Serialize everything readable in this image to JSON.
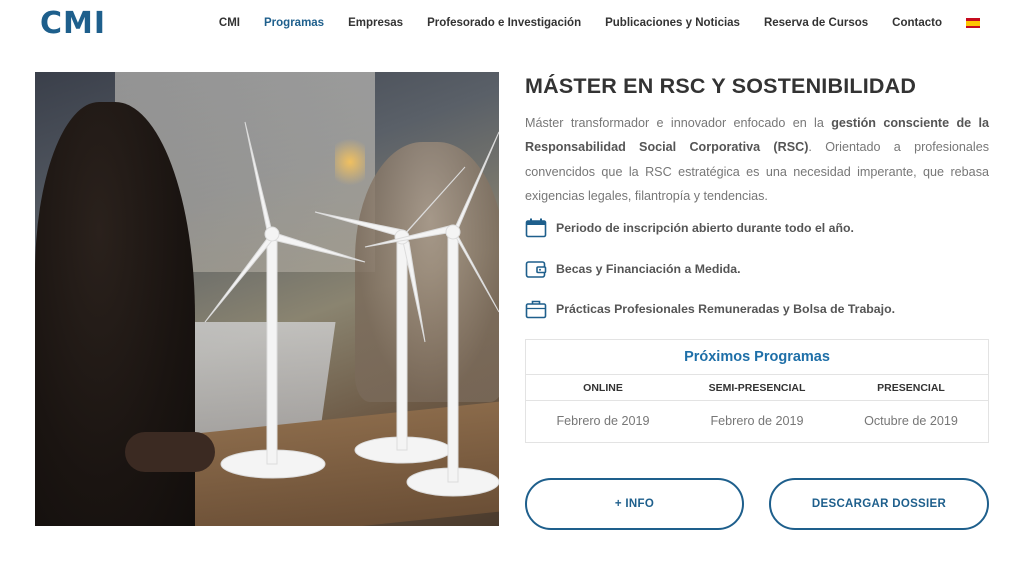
{
  "header": {
    "logo_text": "CMI",
    "nav": [
      {
        "label": "CMI",
        "active": false
      },
      {
        "label": "Programas",
        "active": true
      },
      {
        "label": "Empresas",
        "active": false
      },
      {
        "label": "Profesorado e Investigación",
        "active": false
      },
      {
        "label": "Publicaciones y Noticias",
        "active": false
      },
      {
        "label": "Reserva de Cursos",
        "active": false
      },
      {
        "label": "Contacto",
        "active": false
      }
    ],
    "language_icon": "spain-flag-icon"
  },
  "main": {
    "title": "MÁSTER EN RSC Y SOSTENIBILIDAD",
    "description": {
      "part1": "Máster transformador e innovador enfocado en la ",
      "bold": "gestión consciente de la Responsabilidad Social Corporativa (RSC)",
      "part2": ". Orientado a profesionales convencidos que la RSC estratégica es una necesidad imperante, que rebasa exigencias legales, filantropía y tendencias."
    },
    "features": [
      {
        "icon": "calendar-icon",
        "label": "Periodo de inscripción abierto durante todo el año."
      },
      {
        "icon": "wallet-icon",
        "label": "Becas y Financiación a Medida."
      },
      {
        "icon": "briefcase-icon",
        "label": "Prácticas Profesionales Remuneradas y Bolsa de Trabajo."
      }
    ],
    "programs": {
      "title": "Próximos Programas",
      "headers": [
        "ONLINE",
        "SEMI-PRESENCIAL",
        "PRESENCIAL"
      ],
      "values": [
        "Febrero de 2019",
        "Febrero de 2019",
        "Octubre de 2019"
      ]
    },
    "buttons": {
      "info": "+ INFO",
      "dossier": "DESCARGAR DOSSIER"
    }
  },
  "colors": {
    "brand": "#1e5f8c",
    "accent": "#1e6fa8",
    "text": "#555555"
  }
}
